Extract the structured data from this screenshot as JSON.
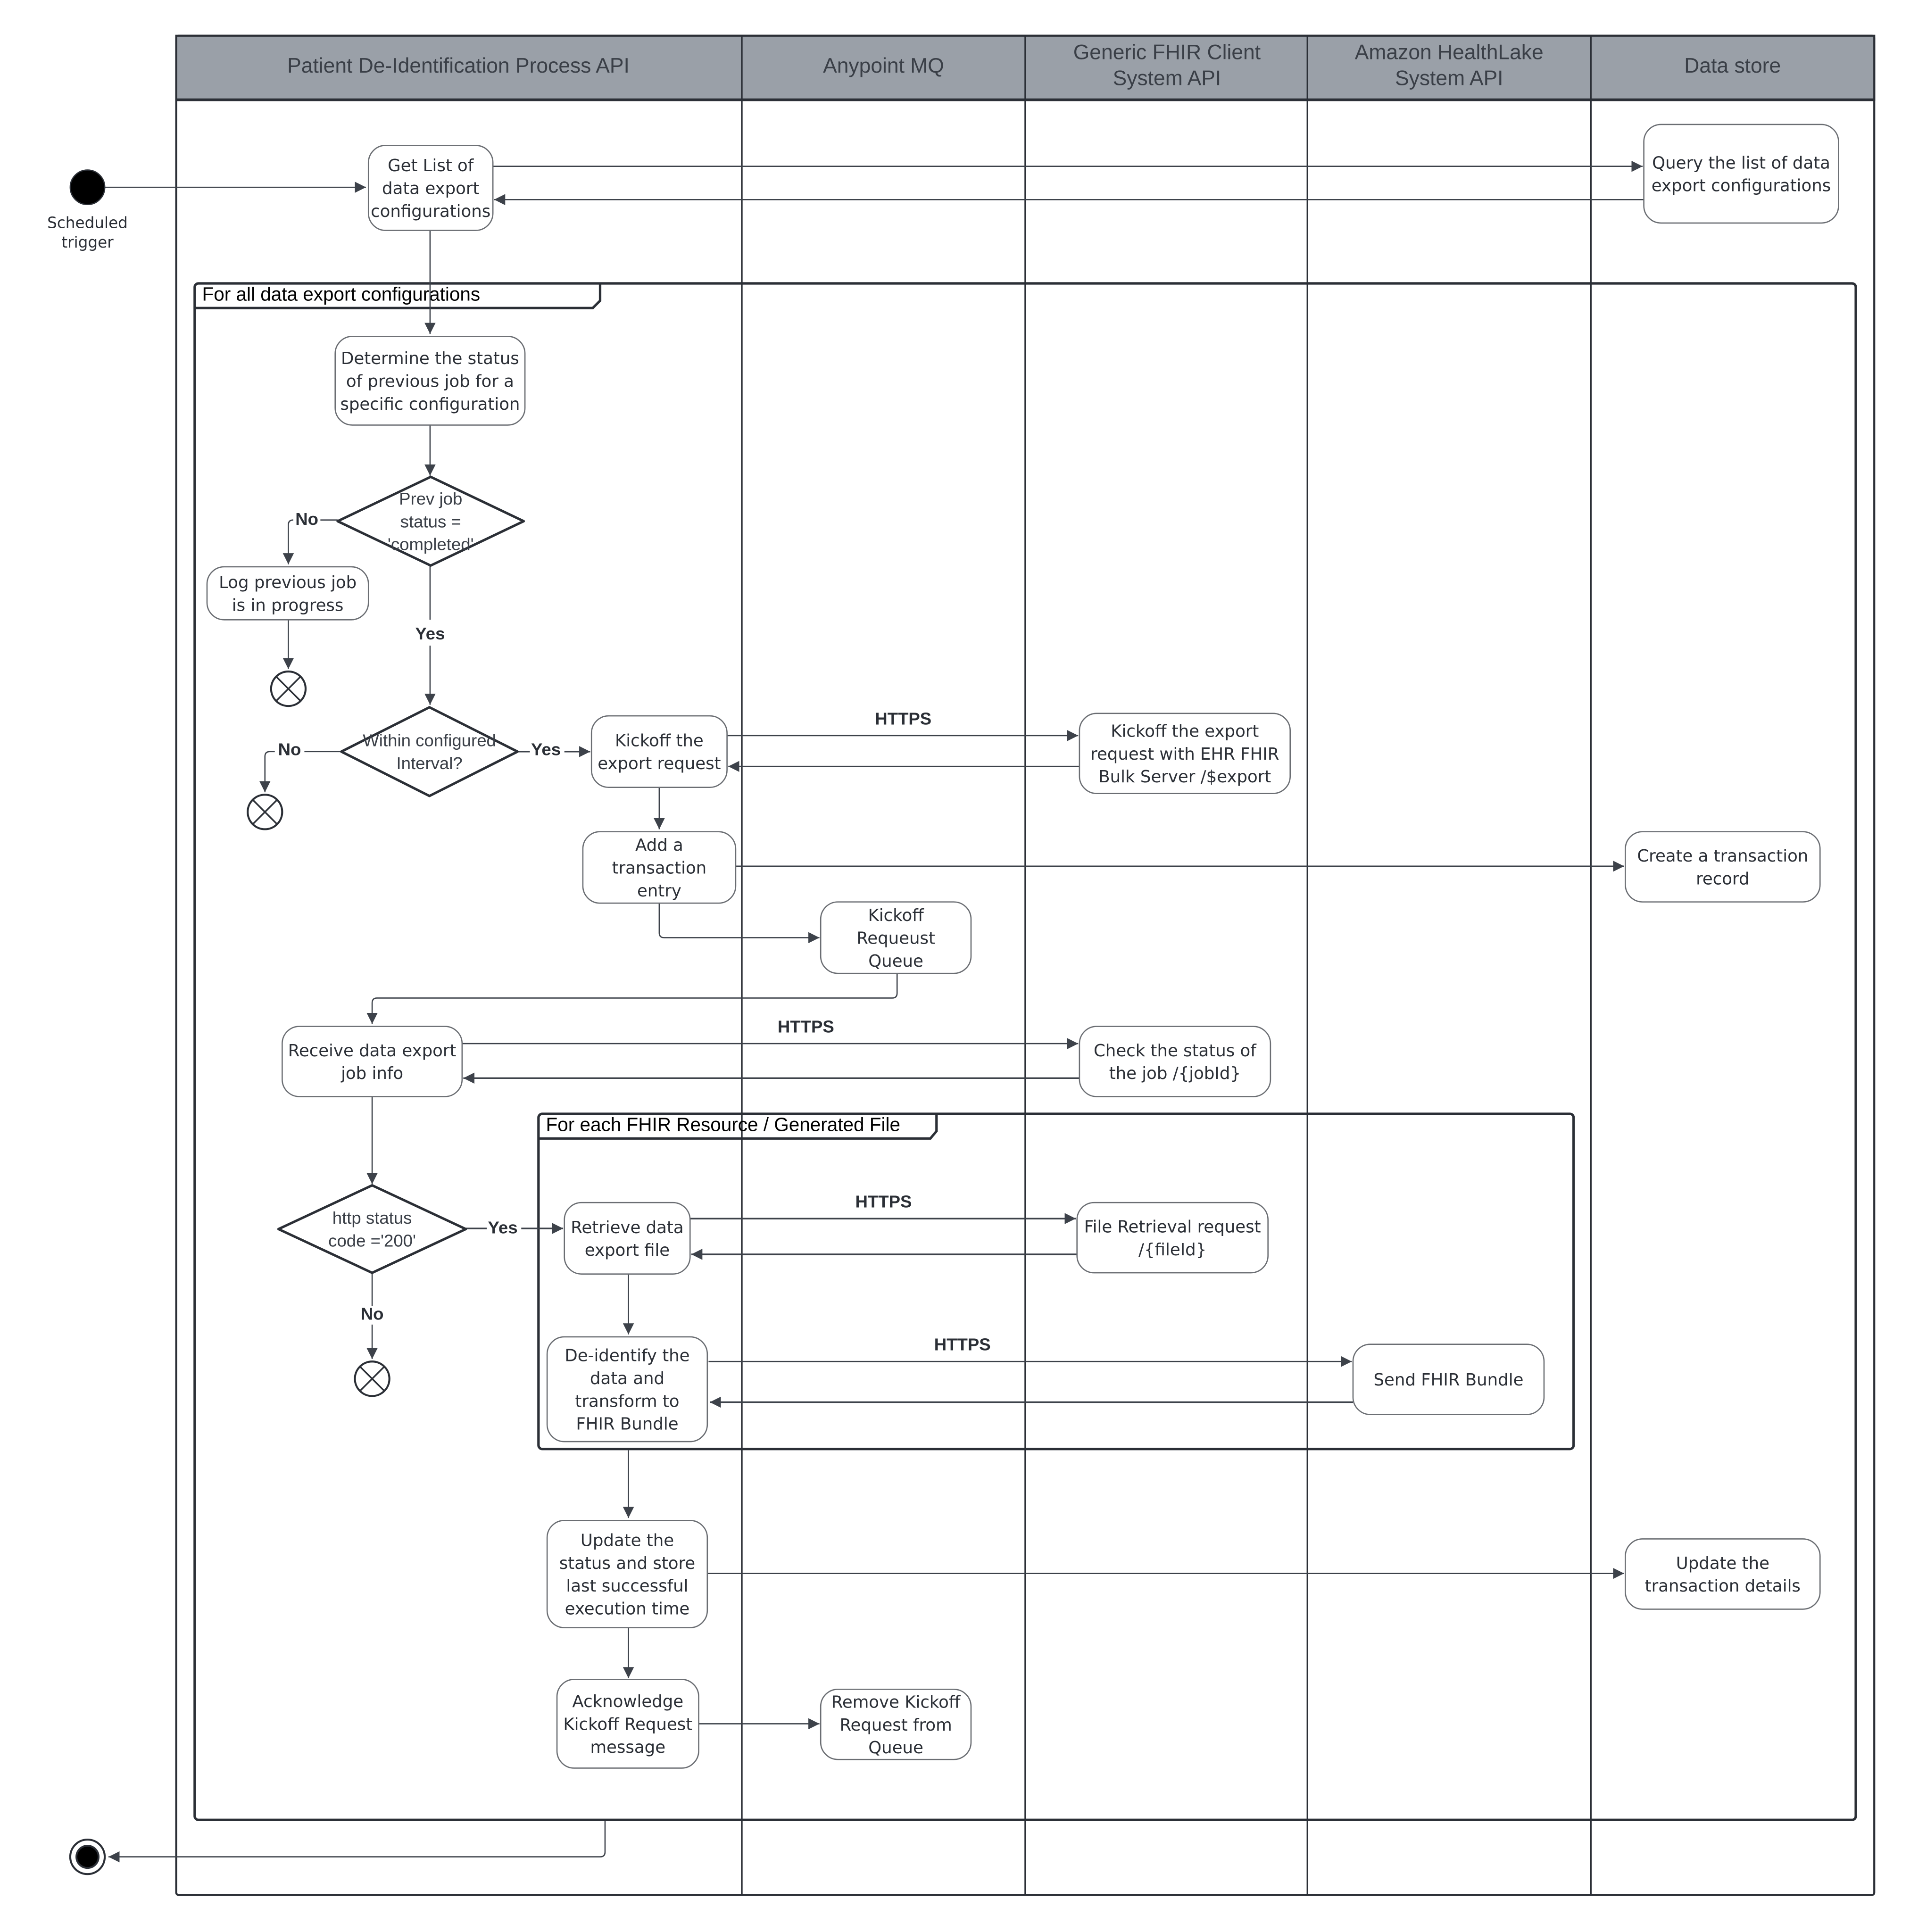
{
  "colors": {
    "header_fill": "#9aa0a8",
    "header_text": "#3a3f47",
    "line": "#3d424a",
    "node_border": "#6b6e73",
    "start_fill": "#000000"
  },
  "lanes": [
    {
      "id": "process",
      "label": [
        "Patient De-Identification Process API"
      ]
    },
    {
      "id": "mq",
      "label": [
        "Anypoint MQ"
      ]
    },
    {
      "id": "fhir",
      "label": [
        "Generic FHIR Client",
        "System API"
      ]
    },
    {
      "id": "healthlake",
      "label": [
        "Amazon HealthLake",
        "System API"
      ]
    },
    {
      "id": "datastore",
      "label": [
        "Data store"
      ]
    }
  ],
  "start": {
    "label": [
      "Scheduled",
      "trigger"
    ],
    "icon": "initial-node-icon"
  },
  "end": {
    "icon": "final-node-icon"
  },
  "frames": {
    "all_configs": "For all data export configurations",
    "each_resource": "For each FHIR Resource / Generated File"
  },
  "nodes": {
    "get_list": [
      "Get List of",
      "data export",
      "configurations"
    ],
    "query_list": [
      "Query the list of data",
      "export configurations"
    ],
    "determine_status": [
      "Determine the status",
      "of previous job for a",
      "specific configuration"
    ],
    "prev_job_decision": [
      "Prev job",
      "status =",
      "'completed'"
    ],
    "log_in_progress": [
      "Log previous job",
      "is in progress"
    ],
    "within_interval_decision": [
      "Within configured",
      "Interval?"
    ],
    "kickoff_export": [
      "Kickoff the",
      "export request"
    ],
    "kickoff_ehr": [
      "Kickoff the export",
      "request with EHR FHIR",
      "Bulk Server /$export"
    ],
    "add_transaction": [
      "Add a",
      "transaction",
      "entry"
    ],
    "create_transaction": [
      "Create a transaction",
      "record"
    ],
    "kickoff_queue": [
      "Kickoff",
      "Requeust",
      "Queue"
    ],
    "receive_job_info": [
      "Receive data export",
      "job info"
    ],
    "check_status": [
      "Check the status of",
      "the job /{jobId}"
    ],
    "http_status_decision": [
      "http status",
      "code ='200'"
    ],
    "retrieve_file": [
      "Retrieve data",
      "export file"
    ],
    "file_retrieval": [
      "File Retrieval request",
      "/{fileId}"
    ],
    "deidentify": [
      "De-identify the",
      "data and",
      "transform to",
      "FHIR Bundle"
    ],
    "send_bundle": [
      "Send FHIR Bundle"
    ],
    "update_status": [
      "Update the",
      "status and store",
      "last successful",
      "execution time"
    ],
    "update_transaction": [
      "Update the",
      "transaction details"
    ],
    "acknowledge": [
      "Acknowledge",
      "Kickoff Request",
      "message"
    ],
    "remove_kickoff": [
      "Remove Kickoff",
      "Request from",
      "Queue"
    ]
  },
  "edge_labels": {
    "no": "No",
    "yes": "Yes",
    "https": "HTTPS"
  }
}
